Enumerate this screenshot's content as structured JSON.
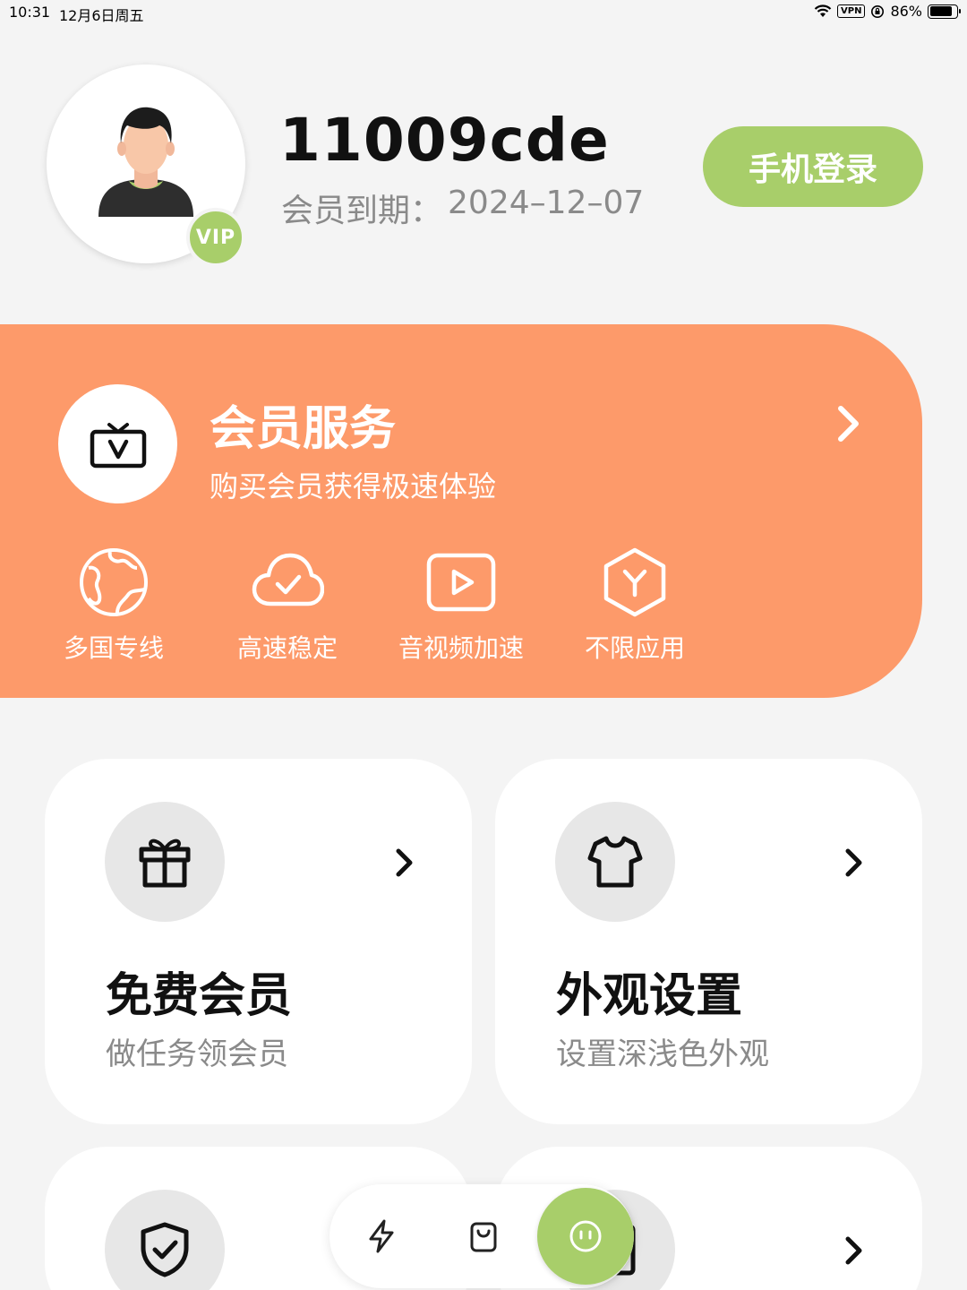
{
  "status_bar": {
    "time": "10:31",
    "date": "12月6日周五",
    "vpn": "VPN",
    "battery": "86%",
    "battery_level": 0.86
  },
  "profile": {
    "username": "11009cde",
    "vip_badge": "VIP",
    "expiry_label": "会员到期：",
    "expiry_date": "2024–12–07",
    "login_button": "手机登录"
  },
  "membership": {
    "title": "会员服务",
    "subtitle": "购买会员获得极速体验",
    "features": [
      {
        "label": "多国专线",
        "icon": "globe-icon"
      },
      {
        "label": "高速稳定",
        "icon": "cloud-check-icon"
      },
      {
        "label": "音视频加速",
        "icon": "play-icon"
      },
      {
        "label": "不限应用",
        "icon": "app-hexagon-icon"
      }
    ]
  },
  "tiles": [
    {
      "title": "免费会员",
      "subtitle": "做任务领会员",
      "icon": "gift-icon"
    },
    {
      "title": "外观设置",
      "subtitle": "设置深浅色外观",
      "icon": "shirt-icon"
    },
    {
      "title": "",
      "subtitle": "",
      "icon": "shield-check-icon"
    },
    {
      "title": "",
      "subtitle": "",
      "icon": "document-icon"
    }
  ],
  "bottom_nav": {
    "items": [
      "lightning-icon",
      "bag-icon",
      "smiley-icon"
    ],
    "active": "smiley-icon"
  },
  "colors": {
    "accent_green": "#a8ce6a",
    "member_orange": "#fd9a6a",
    "background": "#f4f4f4"
  }
}
